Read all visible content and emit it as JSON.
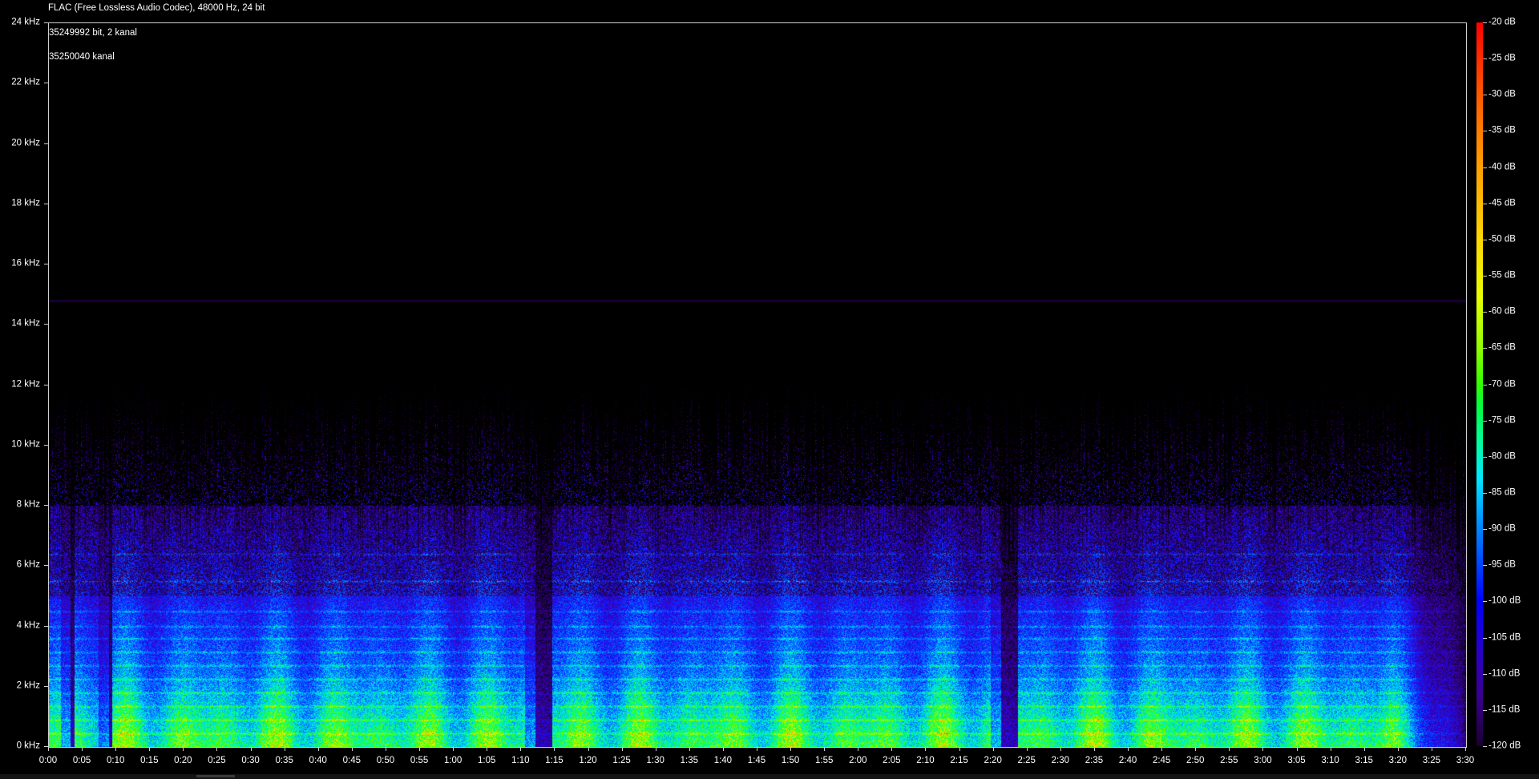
{
  "header": {
    "format_line": "FLAC (Free Lossless Audio Codec), 48000 Hz, 24 bit",
    "info_line_1": "35249992 bit, 2 kanal",
    "info_line_2": "35250040 kanal"
  },
  "y_axis": {
    "ticks": [
      "24 kHz",
      "22 kHz",
      "20 kHz",
      "18 kHz",
      "16 kHz",
      "14 kHz",
      "12 kHz",
      "10 kHz",
      "8 kHz",
      "6 kHz",
      "4 kHz",
      "2 kHz",
      "0 kHz"
    ],
    "range_khz": [
      0,
      24
    ]
  },
  "x_axis": {
    "ticks": [
      "0:00",
      "0:05",
      "0:10",
      "0:15",
      "0:20",
      "0:25",
      "0:30",
      "0:35",
      "0:40",
      "0:45",
      "0:50",
      "0:55",
      "1:00",
      "1:05",
      "1:10",
      "1:15",
      "1:20",
      "1:25",
      "1:30",
      "1:35",
      "1:40",
      "1:45",
      "1:50",
      "1:55",
      "2:00",
      "2:05",
      "2:10",
      "2:15",
      "2:20",
      "2:25",
      "2:30",
      "2:35",
      "2:40",
      "2:45",
      "2:50",
      "2:55",
      "3:00",
      "3:05",
      "3:10",
      "3:15",
      "3:20",
      "3:25",
      "3:30"
    ],
    "duration_seconds": 210
  },
  "colorbar": {
    "ticks": [
      "-20 dB",
      "-25 dB",
      "-30 dB",
      "-35 dB",
      "-40 dB",
      "-45 dB",
      "-50 dB",
      "-55 dB",
      "-60 dB",
      "-65 dB",
      "-70 dB",
      "-75 dB",
      "-80 dB",
      "-85 dB",
      "-90 dB",
      "-95 dB",
      "-100 dB",
      "-105 dB",
      "-110 dB",
      "-115 dB",
      "-120 dB"
    ],
    "range_db": [
      -120,
      -20
    ]
  },
  "spectrogram": {
    "lowpass_cutoff_khz": 14.8,
    "quiet_gaps_seconds": [
      [
        3.2,
        3.8
      ],
      [
        8.8,
        9.3
      ],
      [
        72.0,
        74.5
      ],
      [
        141.0,
        143.5
      ]
    ],
    "fade_out_start_seconds": 199
  }
}
